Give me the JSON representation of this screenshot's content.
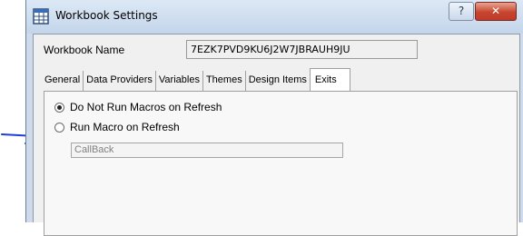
{
  "window": {
    "title": "Workbook Settings",
    "help_button": "?",
    "close_button": "✕"
  },
  "workbook": {
    "name_label": "Workbook Name",
    "name_value": "7EZK7PVD9KU6J2W7JBRAUH9JU"
  },
  "tabs": [
    {
      "label": "General",
      "active": false
    },
    {
      "label": "Data Providers",
      "active": false
    },
    {
      "label": "Variables",
      "active": false
    },
    {
      "label": "Themes",
      "active": false
    },
    {
      "label": "Design Items",
      "active": false
    },
    {
      "label": "Exits",
      "active": true
    }
  ],
  "exits": {
    "options": [
      {
        "label": "Do Not Run Macros on Refresh",
        "checked": true
      },
      {
        "label": "Run Macro on Refresh",
        "checked": false
      }
    ],
    "macro_name": "CallBack"
  },
  "colors": {
    "annotation_arrow": "#1f3fd6",
    "close_button": "#c7462d"
  },
  "icons": [
    "workbook-settings-icon",
    "help-icon",
    "close-icon",
    "annotation-arrow"
  ]
}
